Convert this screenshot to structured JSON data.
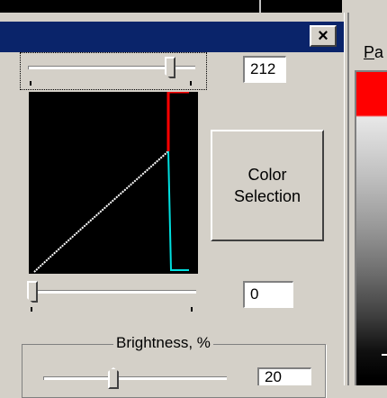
{
  "dialog": {
    "close_label": "×",
    "top_slider_value": 212,
    "top_value": "212",
    "bottom_slider_value": 0,
    "bottom_value": "0",
    "color_button": {
      "line1": "Color",
      "line2": "Selection"
    },
    "brightness": {
      "label": "Brightness, %",
      "value": "20"
    }
  },
  "right_panel": {
    "label_underlined": "P",
    "label_rest": "a"
  },
  "colors": {
    "title_bar": "#0a246a",
    "curve": "#ffffff",
    "cyan": "#00e0e0",
    "red": "#ff0000"
  }
}
